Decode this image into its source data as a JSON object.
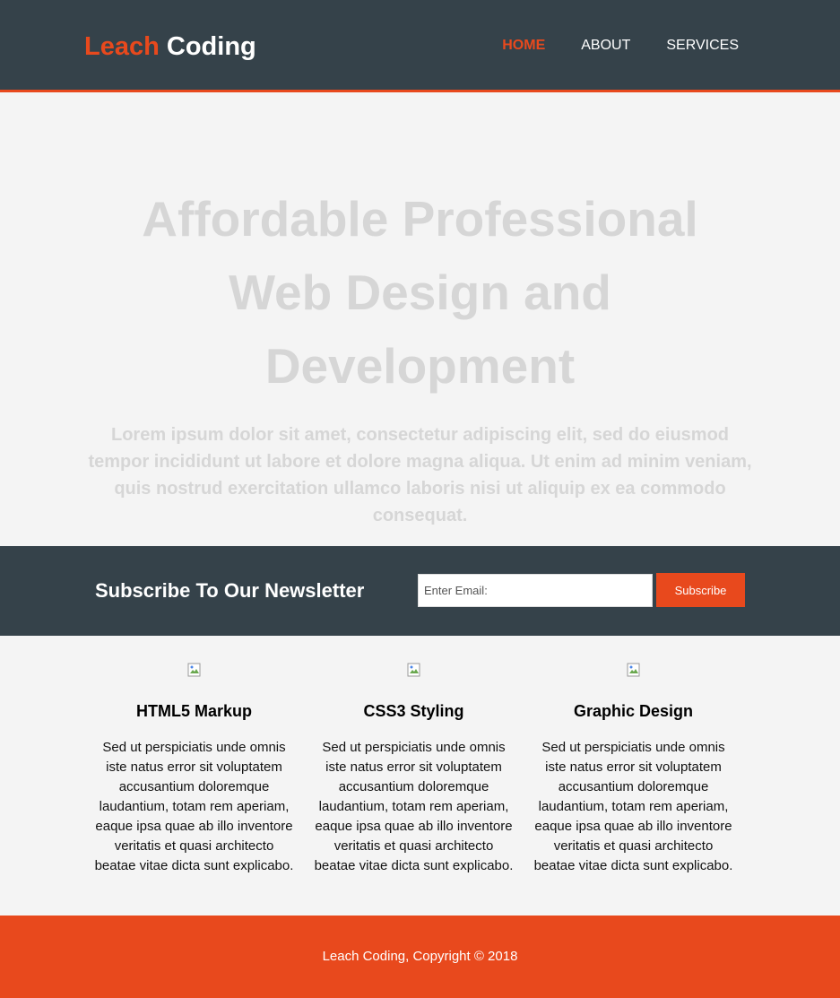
{
  "brand": {
    "highlight": "Leach",
    "rest": "Coding"
  },
  "nav": {
    "items": [
      {
        "label": "Home",
        "current": true
      },
      {
        "label": "About",
        "current": false
      },
      {
        "label": "Services",
        "current": false
      }
    ]
  },
  "showcase": {
    "title": "Affordable Professional Web Design and Development",
    "text": "Lorem ipsum dolor sit amet, consectetur adipiscing elit, sed do eiusmod tempor incididunt ut labore et dolore magna aliqua. Ut enim ad minim veniam, quis nostrud exercitation ullamco laboris nisi ut aliquip ex ea commodo consequat."
  },
  "newsletter": {
    "title": "Subscribe To Our Newsletter",
    "email_placeholder": "Enter Email:",
    "email_value": "",
    "button_label": "Subscribe"
  },
  "boxes": [
    {
      "title": "HTML5 Markup",
      "text": "Sed ut perspiciatis unde omnis iste natus error sit voluptatem accusantium doloremque laudantium, totam rem aperiam, eaque ipsa quae ab illo inventore veritatis et quasi architecto beatae vitae dicta sunt explicabo."
    },
    {
      "title": "CSS3 Styling",
      "text": "Sed ut perspiciatis unde omnis iste natus error sit voluptatem accusantium doloremque laudantium, totam rem aperiam, eaque ipsa quae ab illo inventore veritatis et quasi architecto beatae vitae dicta sunt explicabo."
    },
    {
      "title": "Graphic Design",
      "text": "Sed ut perspiciatis unde omnis iste natus error sit voluptatem accusantium doloremque laudantium, totam rem aperiam, eaque ipsa quae ab illo inventore veritatis et quasi architecto beatae vitae dicta sunt explicabo."
    }
  ],
  "footer": {
    "copyright": "Leach Coding, Copyright © 2018"
  },
  "colors": {
    "dark": "#35424a",
    "accent": "#e8491d",
    "background": "#f4f4f4",
    "faded_text": "#d6d6d6"
  }
}
